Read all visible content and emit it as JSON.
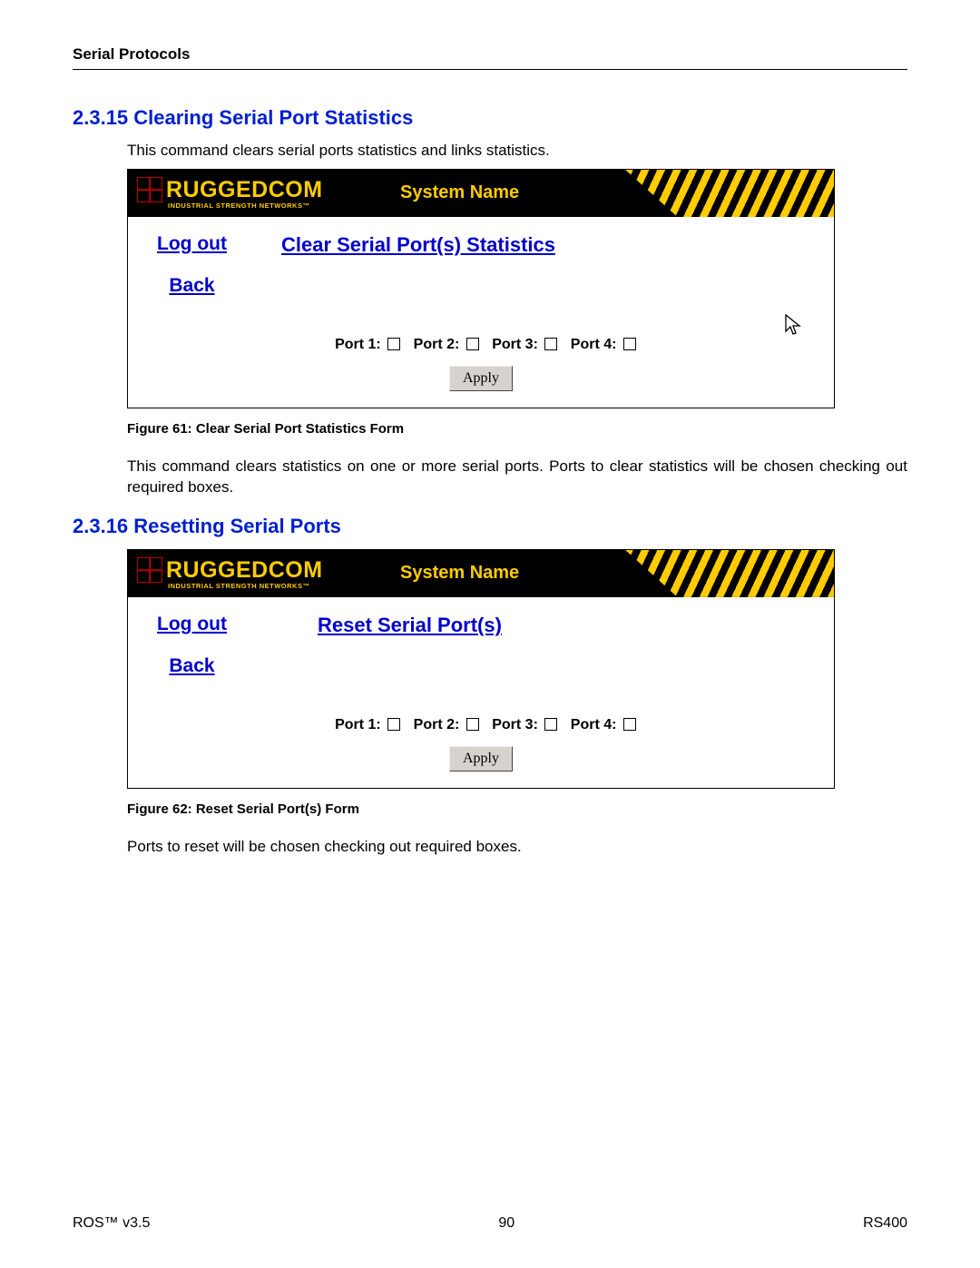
{
  "page_header": "Serial Protocols",
  "section1": {
    "heading": "2.3.15  Clearing Serial Port Statistics",
    "intro": "This command clears serial ports statistics and links statistics.",
    "caption": "Figure 61: Clear Serial Port Statistics Form",
    "description": "This command clears statistics on one or more serial ports. Ports to clear statistics will be chosen checking out required boxes."
  },
  "section2": {
    "heading": "2.3.16  Resetting Serial Ports",
    "caption": "Figure 62: Reset Serial Port(s) Form",
    "description": "Ports to reset will be chosen checking out required boxes."
  },
  "ui": {
    "brand_main": "RUGGEDCOM",
    "brand_sub": "INDUSTRIAL STRENGTH NETWORKS™",
    "system_name": "System Name",
    "logout": "Log out",
    "back": "Back",
    "panel1_title": "Clear Serial Port(s) Statistics",
    "panel2_title": "Reset Serial Port(s)",
    "ports": [
      "Port 1:",
      "Port 2:",
      "Port 3:",
      "Port 4:"
    ],
    "apply": "Apply"
  },
  "footer": {
    "left": "ROS™  v3.5",
    "center": "90",
    "right": "RS400"
  }
}
